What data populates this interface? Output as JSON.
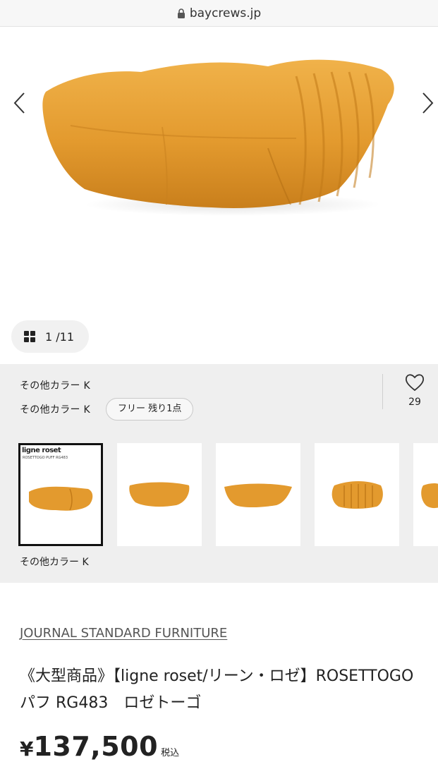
{
  "browser": {
    "url": "baycrews.jp"
  },
  "gallery": {
    "counter": "1 /11"
  },
  "variant": {
    "color_line_1": "その他カラー K",
    "color_line_2": "その他カラー K",
    "stock_label": "フリー 残り1点",
    "favorite_count": "29",
    "thumb_caption": "その他カラー K",
    "thumb_brand": "ligne roset",
    "thumb_sub": "ROSETTOGO PUFF RG483"
  },
  "product": {
    "brand": "JOURNAL STANDARD FURNITURE",
    "title": "《大型商品》【ligne roset/リーン・ロゼ】ROSETTOGO パフ RG483　ロゼトーゴ",
    "currency": "¥",
    "price": "137,500",
    "tax_label": "税込"
  },
  "colors": {
    "product_orange": "#e6a236",
    "panel_bg": "#efefef"
  }
}
